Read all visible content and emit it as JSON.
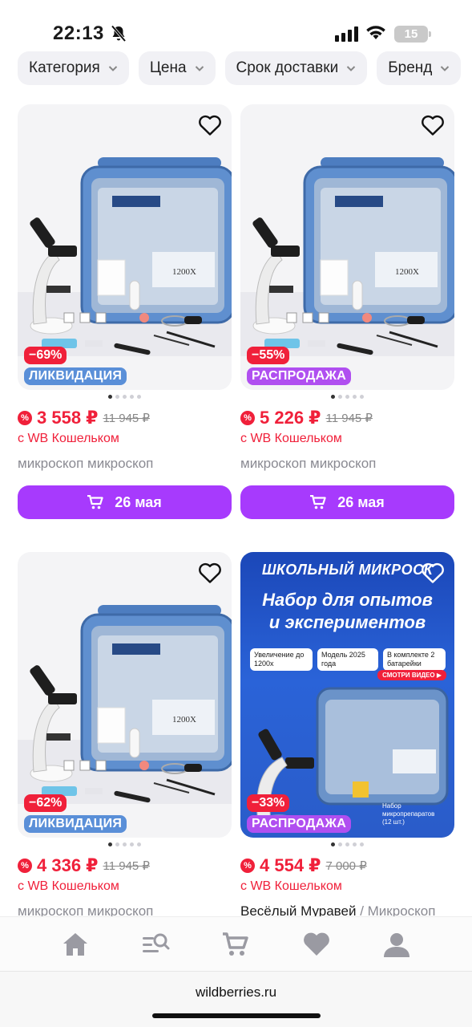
{
  "status": {
    "time": "22:13",
    "battery": "15"
  },
  "filters": [
    "Категория",
    "Цена",
    "Срок доставки",
    "Бренд"
  ],
  "products": [
    {
      "discount": "−69%",
      "tag": "ЛИКВИДАЦИЯ",
      "tag_color": "#5a8fd8",
      "price": "3 558 ₽",
      "old_price": "11 945 ₽",
      "wallet": "с WB Кошельком",
      "title": "микроскоп микроскоп",
      "brand": "",
      "button": "26 мая",
      "image": "microscope-kit"
    },
    {
      "discount": "−55%",
      "tag": "РАСПРОДАЖА",
      "tag_color": "#b04ff0",
      "price": "5 226 ₽",
      "old_price": "11 945 ₽",
      "wallet": "с WB Кошельком",
      "title": "микроскоп микроскоп",
      "brand": "",
      "button": "26 мая",
      "image": "microscope-kit"
    },
    {
      "discount": "−62%",
      "tag": "ЛИКВИДАЦИЯ",
      "tag_color": "#5a8fd8",
      "price": "4 336 ₽",
      "old_price": "11 945 ₽",
      "wallet": "с WB Кошельком",
      "title": "микроскоп микроскоп",
      "brand": "",
      "button": "",
      "image": "microscope-kit"
    },
    {
      "discount": "−33%",
      "tag": "РАСПРОДАЖА",
      "tag_color": "#b04ff0",
      "price": "4 554 ₽",
      "old_price": "7 000 ₽",
      "wallet": "с WB Кошельком",
      "title": " / Микроскоп",
      "brand": "Весёлый Муравей",
      "button": "",
      "image": "school-microscope-promo",
      "promo": {
        "headline": "ШКОЛЬНЫЙ МИКРОСК",
        "subline1": "Набор для опытов",
        "subline2": "и экспериментов",
        "feat1": "Увеличение до 1200х",
        "feat2": "Модель 2025 года",
        "feat3": "В комплекте 2 батарейки",
        "video": "СМОТРИ ВИДЕО ▶",
        "note": "Набор микропрепаратов (12 шт.)"
      }
    }
  ],
  "bottom_nav": [
    "home-icon",
    "catalog-search-icon",
    "cart-icon",
    "favorites-icon",
    "profile-icon"
  ],
  "url": "wildberries.ru"
}
